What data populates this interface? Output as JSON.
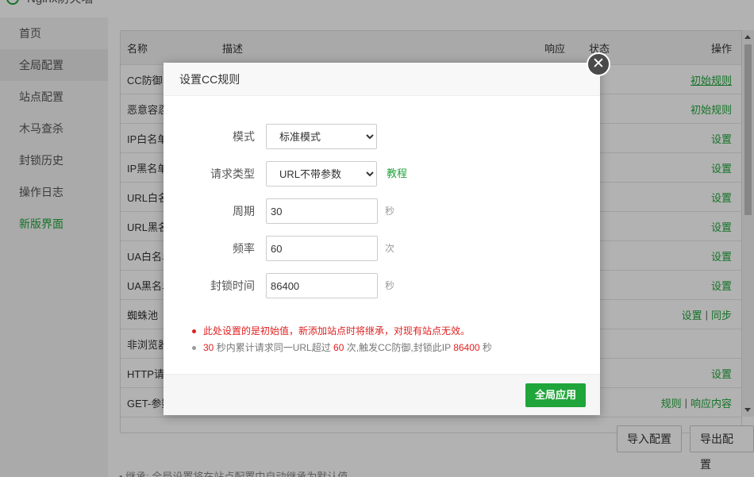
{
  "app": {
    "title": "Nginx防火墙"
  },
  "sidebar": {
    "items": [
      {
        "label": "首页"
      },
      {
        "label": "全局配置"
      },
      {
        "label": "站点配置"
      },
      {
        "label": "木马查杀"
      },
      {
        "label": "封锁历史"
      },
      {
        "label": "操作日志"
      },
      {
        "label": "新版界面"
      }
    ]
  },
  "table": {
    "headers": {
      "name": "名称",
      "desc": "描述",
      "resp": "响应",
      "status": "状态",
      "action": "操作"
    },
    "rows": [
      {
        "name": "CC防御",
        "actions": [
          "初始规则"
        ]
      },
      {
        "name": "恶意容忍",
        "actions": [
          "初始规则"
        ]
      },
      {
        "name": "IP白名单",
        "actions": [
          "设置"
        ]
      },
      {
        "name": "IP黑名单",
        "actions": [
          "设置"
        ]
      },
      {
        "name": "URL白名单",
        "actions": [
          "设置"
        ]
      },
      {
        "name": "URL黑名单",
        "actions": [
          "设置"
        ]
      },
      {
        "name": "UA白名单",
        "actions": [
          "设置"
        ]
      },
      {
        "name": "UA黑名单",
        "actions": [
          "设置"
        ]
      },
      {
        "name": "蜘蛛池",
        "actions": [
          "设置",
          "同步"
        ]
      },
      {
        "name": "非浏览器",
        "actions": []
      },
      {
        "name": "HTTP请求",
        "actions": [
          "设置"
        ]
      },
      {
        "name": "GET-参数",
        "actions": [
          "规则",
          "响应内容"
        ]
      }
    ]
  },
  "bottom": {
    "import_label": "导入配置",
    "export_label": "导出配置",
    "note": "• 继承: 全局设置将在站点配置中自动继承为默认值"
  },
  "modal": {
    "title": "设置CC规则",
    "close_glyph": "✕",
    "mode": {
      "label": "模式",
      "value": "标准模式",
      "options": [
        "标准模式"
      ]
    },
    "request_type": {
      "label": "请求类型",
      "value": "URL不带参数",
      "options": [
        "URL不带参数"
      ],
      "tutorial_link": "教程"
    },
    "cycle": {
      "label": "周期",
      "value": "30",
      "unit": "秒"
    },
    "frequency": {
      "label": "频率",
      "value": "60",
      "unit": "次"
    },
    "block_time": {
      "label": "封锁时间",
      "value": "86400",
      "unit": "秒"
    },
    "tips": {
      "warning": "此处设置的是初始值，新添加站点时将继承，对现有站点无效。",
      "summary": {
        "cycle": "30",
        "t1": " 秒内累计请求同一URL超过 ",
        "freq": "60",
        "t2": " 次,触发CC防御,封锁此IP ",
        "block": "86400",
        "t3": " 秒"
      }
    },
    "apply_label": "全局应用"
  },
  "colors": {
    "accent": "#20a53a",
    "warning": "#e02020"
  }
}
